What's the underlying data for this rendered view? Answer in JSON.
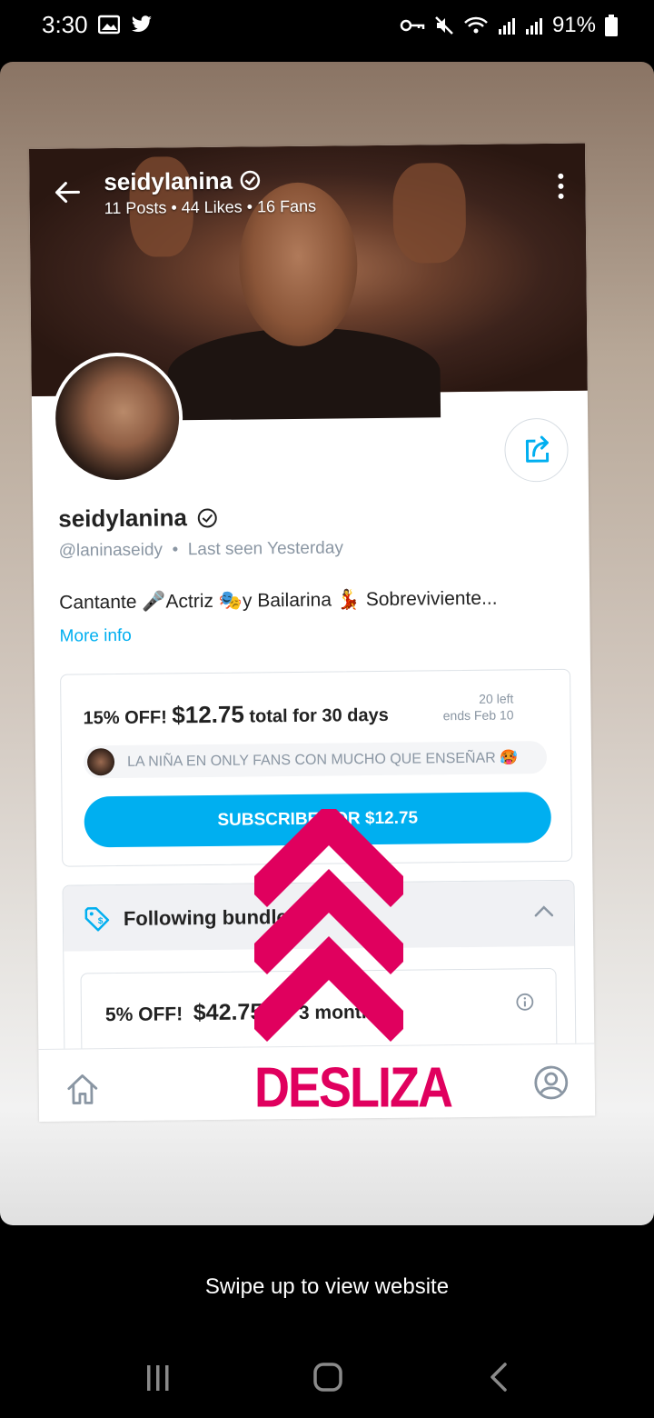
{
  "status_bar": {
    "time": "3:30",
    "battery": "91%"
  },
  "profile": {
    "cover_name": "seidylanina",
    "cover_stats": "11 Posts • 44 Likes • 16 Fans",
    "name": "seidylanina",
    "handle": "@laninaseidy",
    "last_seen": "Last seen Yesterday",
    "bio": "Cantante 🎤Actriz 🎭y Bailarina 💃 Sobreviviente...",
    "more_info": "More info"
  },
  "offer": {
    "discount": "15% OFF!",
    "price": "$12.75",
    "period": "total for 30 days",
    "left": "20 left",
    "ends": "ends Feb 10",
    "message": "LA NIÑA EN ONLY FANS CON MUCHO QUE ENSEÑAR 🥵",
    "subscribe_label": "SUBSCRIBE FOR $12.75"
  },
  "bundles": {
    "title": "Following bundles",
    "item_discount": "5% OFF!",
    "item_price": "$42.75",
    "item_period": "for 3 months"
  },
  "overlay": {
    "desliza": "DESLIZA",
    "swipe_text": "Swipe up to view website"
  },
  "colors": {
    "accent": "#00aff0",
    "overlay_pink": "#e0005e"
  }
}
